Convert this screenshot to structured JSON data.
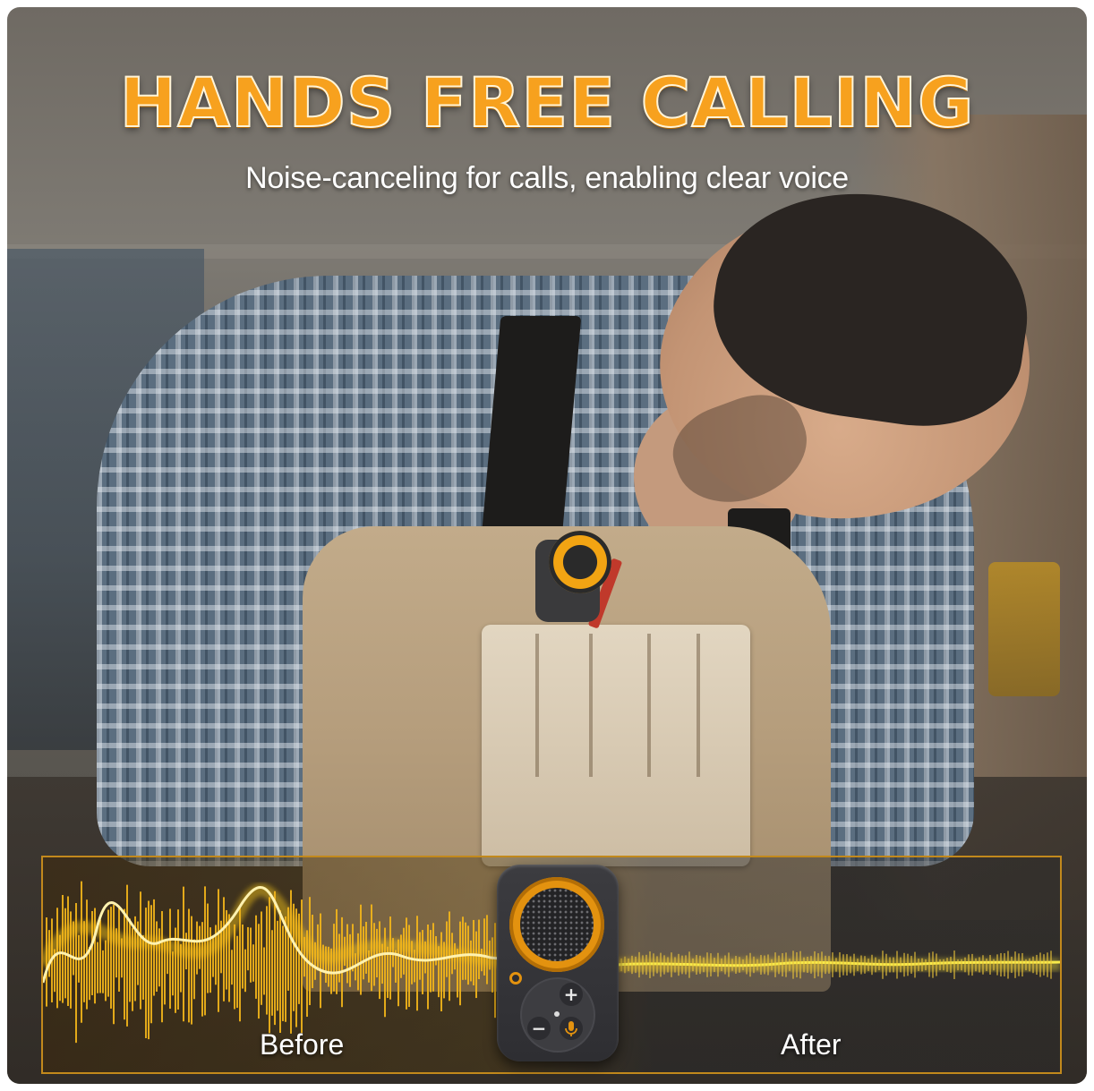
{
  "headline": "HANDS FREE CALLING",
  "subheadline": "Noise-canceling for calls, enabling clear voice",
  "comparison": {
    "before_label": "Before",
    "after_label": "After"
  },
  "device": {
    "plus_symbol": "+",
    "minus_symbol": "−",
    "mic_icon": "microphone-icon",
    "power_icon": "power-icon",
    "accent_color": "#e3920f"
  },
  "colors": {
    "headline": "#f7a11e",
    "wave_glow": "#f5c518",
    "panel_border": "#c2891c"
  }
}
